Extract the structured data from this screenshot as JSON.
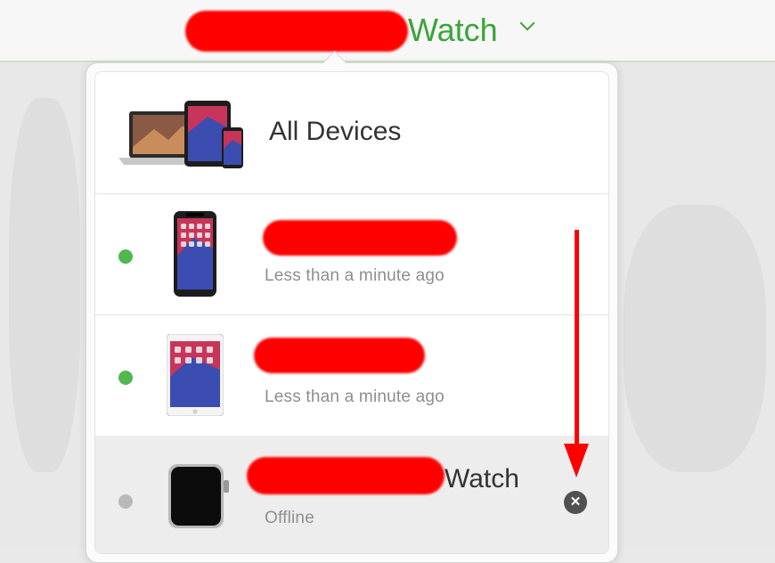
{
  "header": {
    "title_suffix": "Watch"
  },
  "device_list": {
    "all_devices_label": "All Devices",
    "devices": [
      {
        "status": "online",
        "status_text": "Less than a minute ago",
        "icon": "iphone-icon"
      },
      {
        "status": "online",
        "status_text": "Less than a minute ago",
        "icon": "ipad-icon"
      },
      {
        "status": "offline",
        "name_suffix": "Watch",
        "status_text": "Offline",
        "icon": "apple-watch-icon",
        "remove_glyph": "✕"
      }
    ]
  },
  "colors": {
    "accent_green": "#3aa53a",
    "online_dot": "#4fb84f",
    "offline_dot": "#b9b9b9",
    "annotation_red": "#ff0000"
  }
}
